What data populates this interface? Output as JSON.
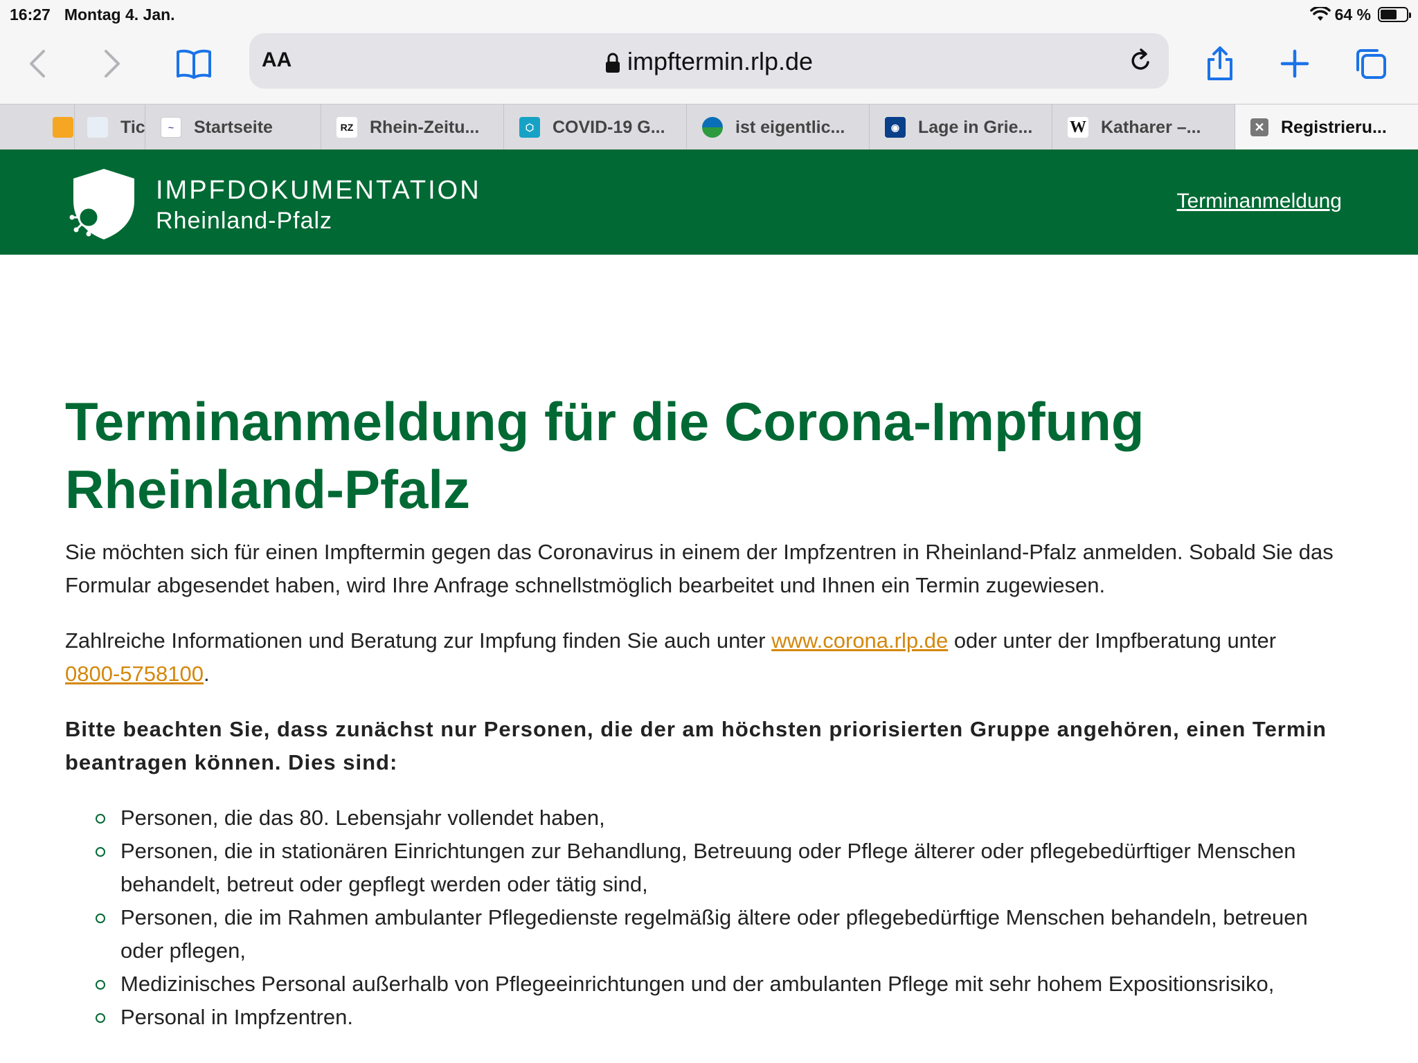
{
  "status": {
    "time": "16:27",
    "date": "Montag 4. Jan.",
    "battery": "64 %",
    "battery_level": 0.64
  },
  "toolbar": {
    "aa_label": "AA",
    "url": "impftermin.rlp.de"
  },
  "tabs": [
    {
      "label": "",
      "favicon": "orange-tab-icon"
    },
    {
      "label": "Tic",
      "favicon": "tic-icon"
    },
    {
      "label": "Startseite",
      "favicon": "startseite-icon"
    },
    {
      "label": "Rhein-Zeitu...",
      "favicon": "RZ"
    },
    {
      "label": "COVID-19 G...",
      "favicon": "covid-icon"
    },
    {
      "label": "ist eigentlic...",
      "favicon": "globe-icon"
    },
    {
      "label": "Lage in Grie...",
      "favicon": "tagesschau-icon"
    },
    {
      "label": "Katharer –...",
      "favicon": "W"
    },
    {
      "label": "Registrieru...",
      "favicon": "close-icon"
    }
  ],
  "header": {
    "title": "IMPFDOKUMENTATION",
    "subtitle": "Rheinland-Pfalz",
    "nav_link": "Terminanmeldung"
  },
  "main": {
    "heading_line1": "Terminanmeldung für die Corona-Impfung",
    "heading_line2": "Rheinland-Pfalz",
    "intro": "Sie möchten sich für einen Impftermin gegen das Coronavirus in einem der Impfzentren in Rheinland-Pfalz anmelden. Sobald Sie das Formular abgesendet haben, wird Ihre Anfrage schnellstmöglich bearbeitet und Ihnen ein Termin zugewiesen.",
    "info_prefix": "Zahlreiche Informationen und Beratung zur Impfung finden Sie auch unter ",
    "info_link": "www.corona.rlp.de",
    "info_middle": " oder unter der Impfberatung unter ",
    "info_phone": "0800-5758100",
    "info_suffix": ".",
    "notice": "Bitte beachten Sie, dass zunächst nur Personen, die der am höchsten priorisierten Gruppe angehören, einen Termin beantragen können. Dies sind:",
    "groups": [
      "Personen, die das 80. Lebensjahr vollendet haben,",
      "Personen, die in stationären Einrichtungen zur Behandlung, Betreuung oder Pflege älterer oder pflegebedürftiger Menschen behandelt, betreut oder gepflegt werden oder tätig sind,",
      "Personen, die im Rahmen ambulanter Pflegedienste regelmäßig ältere oder pflegebedürftige Menschen behandeln, betreuen oder pflegen,",
      "Medizinisches Personal außerhalb von Pflegeeinrichtungen und der ambulanten Pflege mit sehr hohem Expositionsrisiko,",
      "Personal in Impfzentren."
    ]
  },
  "colors": {
    "brand_green": "#016934",
    "link_orange": "#d4870b"
  }
}
